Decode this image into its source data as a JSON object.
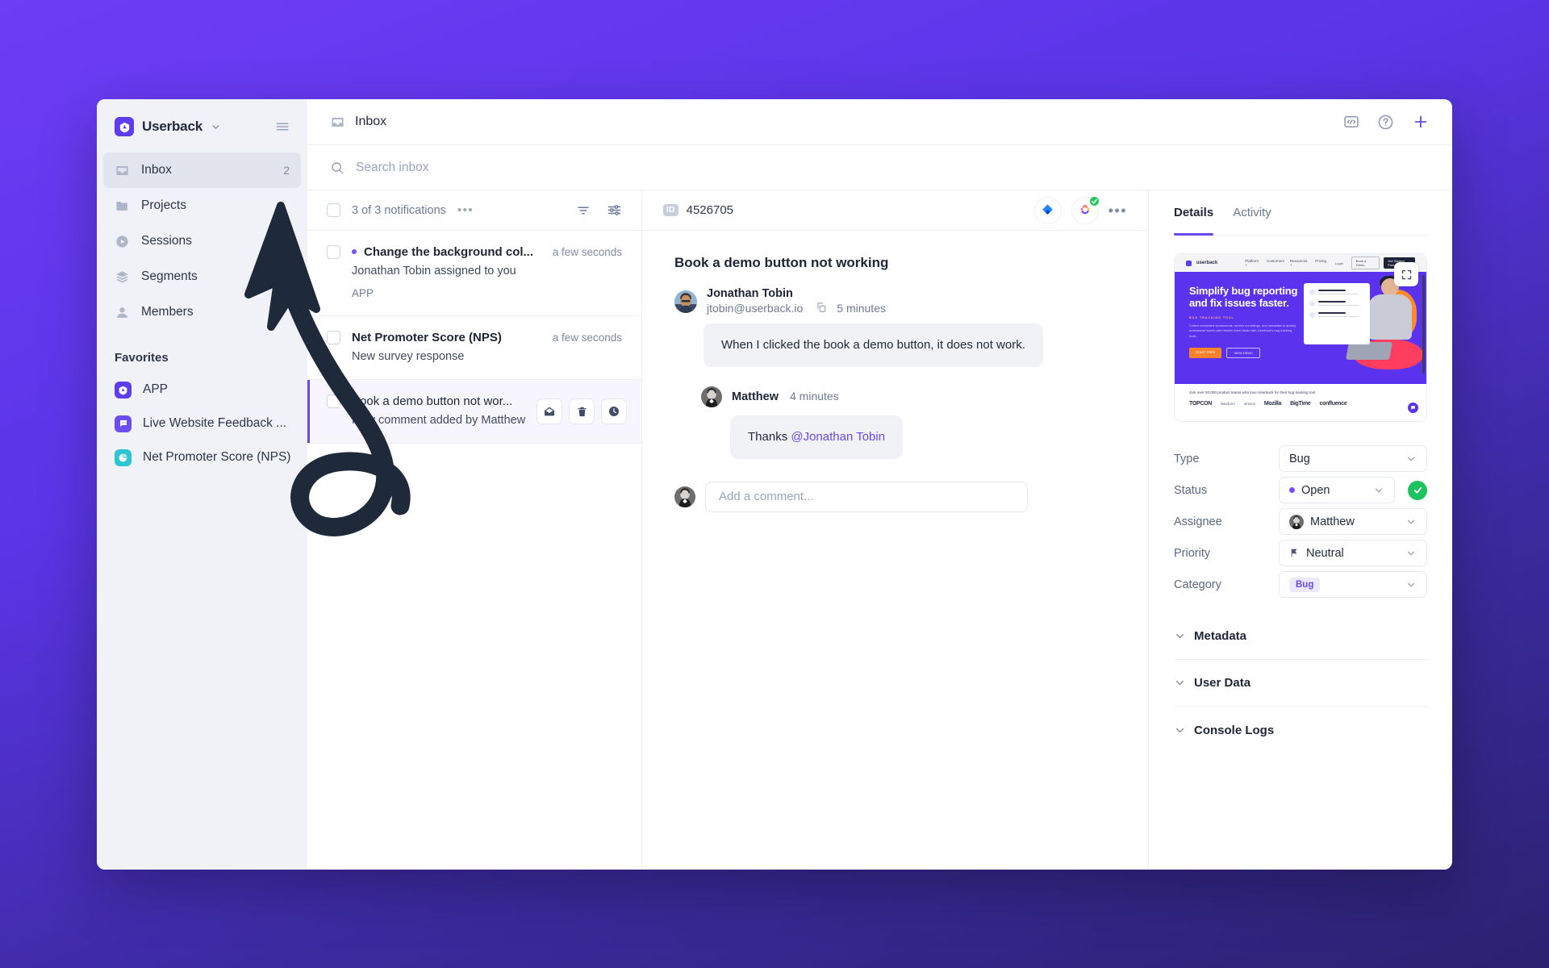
{
  "sidebar": {
    "brand": {
      "name": "Userback",
      "logo_icon": "userback-logo-icon",
      "caret_icon": "chevron-down-icon",
      "menu_icon": "hamburger-menu-icon"
    },
    "items": [
      {
        "label": "Inbox",
        "icon": "inbox-icon",
        "badge": "2",
        "active": true
      },
      {
        "label": "Projects",
        "icon": "folder-icon",
        "badge": "",
        "active": false
      },
      {
        "label": "Sessions",
        "icon": "play-circle-icon",
        "badge": "",
        "active": false
      },
      {
        "label": "Segments",
        "icon": "layers-icon",
        "badge": "",
        "active": false
      },
      {
        "label": "Members",
        "icon": "user-icon",
        "badge": "",
        "active": false
      }
    ],
    "favorites_heading": "Favorites",
    "favorites": [
      {
        "label": "APP",
        "icon": "userback-logo-icon",
        "color": "#5f3dec"
      },
      {
        "label": "Live Website Feedback ...",
        "icon": "chat-bubble-icon",
        "color": "#6b4df0"
      },
      {
        "label": "Net Promoter Score (NPS)",
        "icon": "pie-chart-icon",
        "color": "#2ec5d3"
      }
    ]
  },
  "topbar": {
    "icon": "inbox-icon",
    "title": "Inbox",
    "actions": [
      {
        "name": "code-snippet-icon",
        "glyph": "code"
      },
      {
        "name": "help-circle-icon",
        "glyph": "help"
      },
      {
        "name": "add-plus-icon",
        "glyph": "plus"
      }
    ]
  },
  "search": {
    "placeholder": "Search inbox",
    "value": "",
    "icon": "search-icon"
  },
  "list": {
    "count_label": "3 of 3 notifications",
    "more_icon": "ellipsis-icon",
    "filter_icon": "filter-icon",
    "settings_icon": "sliders-icon",
    "notifications": [
      {
        "title": "Change the background col...",
        "subtitle": "Jonathan Tobin assigned to you",
        "tag": "APP",
        "time": "a few seconds",
        "unread": true,
        "selected": false
      },
      {
        "title": "Net Promoter Score (NPS)",
        "subtitle": "New survey response",
        "tag": "",
        "time": "a few seconds",
        "unread": false,
        "selected": false
      },
      {
        "title": "Book a demo button not wor...",
        "subtitle": "New comment added by Matthew",
        "tag": "",
        "time": "",
        "unread": false,
        "selected": true,
        "row_actions": [
          {
            "name": "mark-read-envelope-icon"
          },
          {
            "name": "delete-trash-icon"
          },
          {
            "name": "snooze-clock-icon"
          }
        ]
      }
    ]
  },
  "conversation": {
    "id_badge": "ID",
    "id_value": "4526705",
    "jira_icon": "jira-integration-icon",
    "integration_icon": "asana-integration-icon",
    "integration_status_icon": "check-circle-icon",
    "more_icon": "ellipsis-icon",
    "title": "Book a demo button not working",
    "messages": [
      {
        "author": "Jonathan Tobin",
        "email": "jtobin@userback.io",
        "copy_icon": "copy-icon",
        "time": "5 minutes",
        "text": "When I clicked the book a demo button, it does not work."
      },
      {
        "author": "Matthew",
        "email": "",
        "time": "4 minutes",
        "text": "Thanks ",
        "mention": "@Jonathan Tobin"
      }
    ],
    "composer_placeholder": "Add a comment...",
    "composer_value": ""
  },
  "details": {
    "tabs": [
      {
        "label": "Details",
        "active": true
      },
      {
        "label": "Activity",
        "active": false
      }
    ],
    "screenshot": {
      "expand_icon": "fullscreen-expand-icon",
      "brand": "userback",
      "nav_links": [
        "Platform +",
        "Customers",
        "Resources +",
        "Pricing"
      ],
      "nav_buttons": [
        "Login",
        "Book a Demo",
        "Get Started Free"
      ],
      "headline_line1": "Simplify bug reporting",
      "headline_line2": "and fix issues faster.",
      "kicker": "BUG TRACKING TOOL",
      "paragraph": "Collect annotated screenshots, screen recordings, and metadata to quickly understand issues and resolve them faster with Userback's bug tracking tools.",
      "cta_primary": "START FREE",
      "cta_secondary": "VIEW DEMO",
      "footer_title": "Join over 20,000 product teams who love Userback for their bug tracking tool",
      "footer_logos": [
        "TOPCON",
        "Bandicam",
        "amazon",
        "Mozilla",
        "BigTime",
        "confluence"
      ]
    },
    "fields": [
      {
        "label": "Type",
        "value": "Bug",
        "kind": "plain"
      },
      {
        "label": "Status",
        "value": "Open",
        "kind": "status",
        "confirm_icon": "check-icon"
      },
      {
        "label": "Assignee",
        "value": "Matthew",
        "kind": "assignee"
      },
      {
        "label": "Priority",
        "value": "Neutral",
        "kind": "priority",
        "icon": "flag-icon"
      },
      {
        "label": "Category",
        "value": "Bug",
        "kind": "chip"
      }
    ],
    "sections": [
      {
        "label": "Metadata",
        "caret_icon": "chevron-down-icon"
      },
      {
        "label": "User Data",
        "caret_icon": "chevron-down-icon"
      },
      {
        "label": "Console Logs",
        "caret_icon": "chevron-down-icon"
      }
    ]
  },
  "annotation": {
    "name": "hand-drawn-arrow",
    "color": "#1e2a3a"
  }
}
